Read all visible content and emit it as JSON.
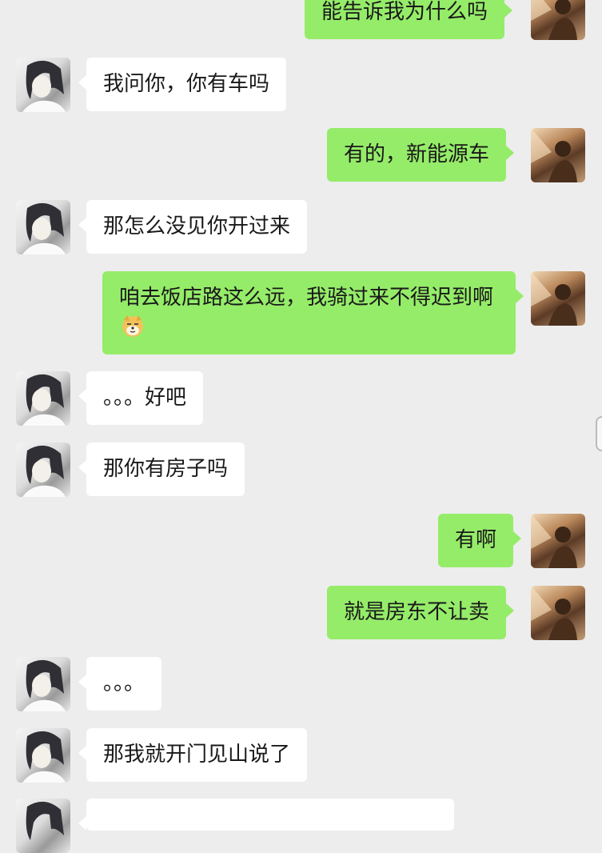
{
  "messages": [
    {
      "side": "right",
      "text": "能告诉我为什么吗"
    },
    {
      "side": "left",
      "text": "我问你，你有车吗"
    },
    {
      "side": "right",
      "text": "有的，新能源车"
    },
    {
      "side": "left",
      "text": "那怎么没见你开过来"
    },
    {
      "side": "right",
      "text": "咱去饭店路这么远，我骑过来不得迟到啊",
      "emoji": "doge-emoji"
    },
    {
      "side": "left",
      "text": "。。。好吧"
    },
    {
      "side": "left",
      "text": "那你有房子吗"
    },
    {
      "side": "right",
      "text": "有啊"
    },
    {
      "side": "right",
      "text": "就是房东不让卖"
    },
    {
      "side": "left",
      "text": "。。。"
    },
    {
      "side": "left",
      "text": "那我就开门见山说了"
    }
  ],
  "colors": {
    "background": "#ededed",
    "self_bubble": "#95ec69",
    "other_bubble": "#ffffff"
  }
}
